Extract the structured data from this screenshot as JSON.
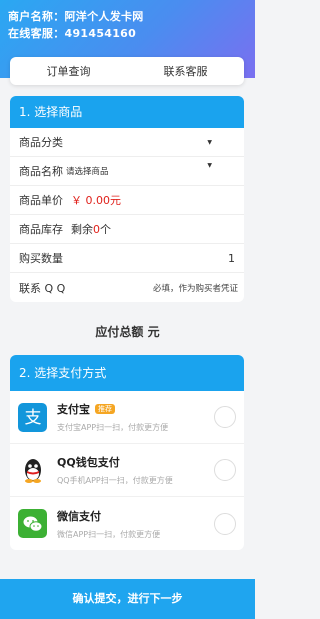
{
  "header": {
    "merchant": "商户名称：阿洋个人发卡网",
    "service": "在线客服：491454160"
  },
  "tabs": [
    {
      "label": "订单查询"
    },
    {
      "label": "联系客服"
    }
  ],
  "goods_section": {
    "title": "1. 选择商品",
    "category_label": "商品分类",
    "name_label": "商品名称",
    "name_placeholder": "请选择商品",
    "price_label": "商品单价",
    "price_value": "￥ 0.00元",
    "stock_label": "商品库存",
    "stock_prefix": "剩余",
    "stock_count": "0",
    "stock_unit": "个",
    "qty_label": "购买数量",
    "qty_value": "1",
    "qq_label": "联系 Q Q",
    "qq_placeholder": "必填，作为购买者凭证"
  },
  "total": {
    "label": "应付总额 元"
  },
  "pay_section": {
    "title": "2. 选择支付方式",
    "methods": [
      {
        "name": "支付宝",
        "badge": "推荐",
        "desc": "支付宝APP扫一扫，付款更方便",
        "icon": "alipay-icon"
      },
      {
        "name": "QQ钱包支付",
        "badge": "",
        "desc": "QQ手机APP扫一扫，付款更方便",
        "icon": "qq-icon"
      },
      {
        "name": "微信支付",
        "badge": "",
        "desc": "微信APP扫一扫，付款更方便",
        "icon": "wechat-icon"
      }
    ]
  },
  "submit": {
    "label": "确认提交，进行下一步"
  },
  "colors": {
    "accent": "#1aa3ee",
    "price": "#e0221c",
    "badge": "#f5a623"
  }
}
